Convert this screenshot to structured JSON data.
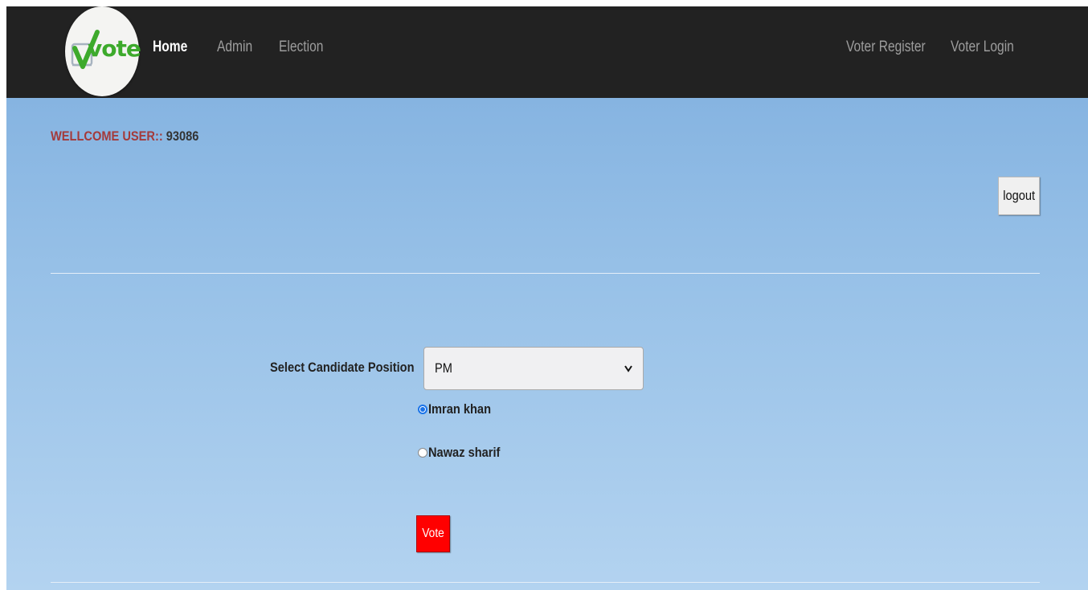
{
  "navbar": {
    "logo_text": "vote",
    "links": {
      "home": "Home",
      "admin": "Admin",
      "election": "Election",
      "voter_register": "Voter Register",
      "voter_login": "Voter Login"
    },
    "background": "#222222",
    "active_link_color": "#ffffff",
    "link_color": "#9d9d9d"
  },
  "welcome": {
    "label": "WELLCOME USER::",
    "user_id": "93086",
    "label_color": "#a43a3a"
  },
  "logout_label": "logout",
  "form": {
    "select_label": "Select Candidate Position",
    "selected_position": "PM",
    "candidates": [
      {
        "name": "Imran khan",
        "checked": true
      },
      {
        "name": "Nawaz sharif",
        "checked": false
      }
    ],
    "vote_label": "Vote",
    "vote_color": "#ff0000"
  },
  "icons": {
    "logo": "vote-logo",
    "dropdown": "chevron-down-icon"
  }
}
